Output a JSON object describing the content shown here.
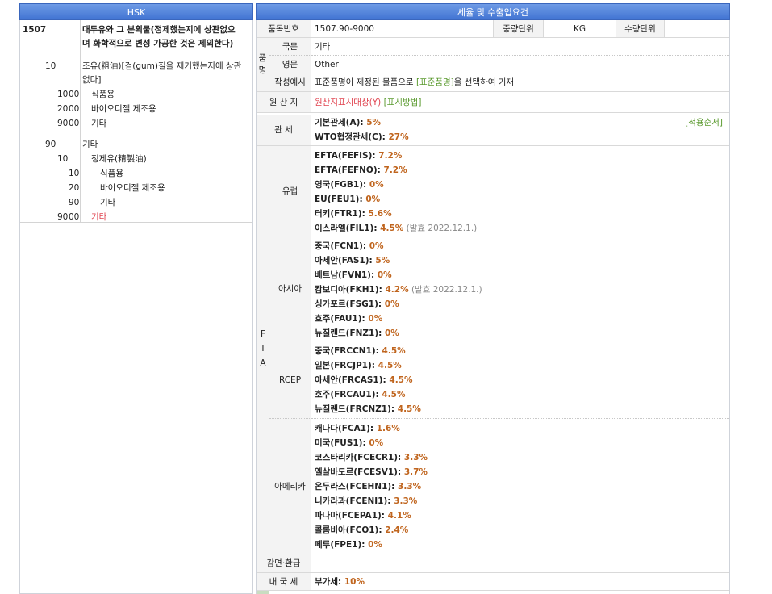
{
  "left": {
    "header": "HSK",
    "heading_code": "1507",
    "heading_desc_1": "대두유와 그 분획물(정제했는지에 상관없으",
    "heading_desc_2": "며 화학적으로 변성 가공한 것은 제외한다)",
    "rows": [
      {
        "c1": "10",
        "c2": "",
        "desc": "조유(粗油)[검(gum)질을 제거했는지에 상관",
        "desc2": "없다]"
      },
      {
        "c1": "10",
        "c2": "00",
        "desc": "식품용"
      },
      {
        "c1": "20",
        "c2": "00",
        "desc": "바이오디젤 제조용"
      },
      {
        "c1": "90",
        "c2": "00",
        "desc": "기타"
      },
      {
        "c1": "90",
        "c2": "",
        "desc": "기타"
      },
      {
        "c1": "10",
        "c2": "",
        "desc": "정제유(精製油)"
      },
      {
        "c1": "10",
        "c2": "",
        "desc": "식품용"
      },
      {
        "c1": "20",
        "c2": "",
        "desc": "바이오디젤 제조용"
      },
      {
        "c1": "90",
        "c2": "",
        "desc": "기타"
      },
      {
        "c1": "90",
        "c2": "00",
        "desc": "기타"
      }
    ]
  },
  "right": {
    "header": "세율 및 수출입요건",
    "item_no_label": "품목번호",
    "item_no": "1507.90-9000",
    "weight_unit_label": "중량단위",
    "weight_unit": "KG",
    "qty_unit_label": "수량단위",
    "qty_unit": "",
    "name_group_label": "품명",
    "korean_label": "국문",
    "korean_value": "기타",
    "english_label": "영문",
    "english_value": "Other",
    "example_label": "작성예시",
    "example_pre": "표준품명이 제정된 물품으로 ",
    "example_link": "[표준품명]",
    "example_post": "을 선택하여 기재",
    "origin_label": "원 산 지",
    "origin_link_1": "원산지표시대상(Y)",
    "origin_link_2": "[표시방법]",
    "tariff_label": "관   세",
    "basic_label": "기본관세(A): ",
    "basic_rate": "5%",
    "wto_label": "WTO협정관세(C): ",
    "wto_rate": "27%",
    "apply_order_link": "[적용순서]",
    "fta_label": "F T A",
    "fta_groups": [
      {
        "name": "유럽",
        "items": [
          {
            "label": "EFTA(FEFIS): ",
            "rate": "7.2%"
          },
          {
            "label": "EFTA(FEFNO): ",
            "rate": "7.2%"
          },
          {
            "label": "영국(FGB1): ",
            "rate": "0%"
          },
          {
            "label": "EU(FEU1): ",
            "rate": "0%"
          },
          {
            "label": "터키(FTR1): ",
            "rate": "5.6%"
          },
          {
            "label": "이스라엘(FIL1): ",
            "rate": "4.5%",
            "note": " (발효 2022.12.1.)"
          }
        ]
      },
      {
        "name": "아시아",
        "items": [
          {
            "label": "중국(FCN1): ",
            "rate": "0%"
          },
          {
            "label": "아세안(FAS1): ",
            "rate": "5%"
          },
          {
            "label": "베트남(FVN1): ",
            "rate": "0%"
          },
          {
            "label": "캄보디아(FKH1): ",
            "rate": "4.2%",
            "note": " (발효 2022.12.1.)"
          },
          {
            "label": "싱가포르(FSG1): ",
            "rate": "0%"
          },
          {
            "label": "호주(FAU1): ",
            "rate": "0%"
          },
          {
            "label": "뉴질랜드(FNZ1): ",
            "rate": "0%"
          }
        ]
      },
      {
        "name": "RCEP",
        "items": [
          {
            "label": "중국(FRCCN1): ",
            "rate": "4.5%"
          },
          {
            "label": "일본(FRCJP1): ",
            "rate": "4.5%"
          },
          {
            "label": "아세안(FRCAS1): ",
            "rate": "4.5%"
          },
          {
            "label": "호주(FRCAU1): ",
            "rate": "4.5%"
          },
          {
            "label": "뉴질랜드(FRCNZ1): ",
            "rate": "4.5%"
          }
        ]
      },
      {
        "name": "아메리카",
        "items": [
          {
            "label": "캐나다(FCA1): ",
            "rate": "1.6%"
          },
          {
            "label": "미국(FUS1): ",
            "rate": "0%"
          },
          {
            "label": "코스타리카(FCECR1): ",
            "rate": "3.3%"
          },
          {
            "label": "엘살바도르(FCESV1): ",
            "rate": "3.7%"
          },
          {
            "label": "온두라스(FCEHN1): ",
            "rate": "3.3%"
          },
          {
            "label": "니카라과(FCENI1): ",
            "rate": "3.3%"
          },
          {
            "label": "파나마(FCEPA1): ",
            "rate": "4.1%"
          },
          {
            "label": "콜롬비아(FCO1): ",
            "rate": "2.4%"
          },
          {
            "label": "페루(FPE1): ",
            "rate": "0%"
          }
        ]
      }
    ],
    "reduction_label": "감면·환급",
    "domestic_label": "내 국 세",
    "vat_label": "부가세: ",
    "vat_rate": "10%"
  }
}
